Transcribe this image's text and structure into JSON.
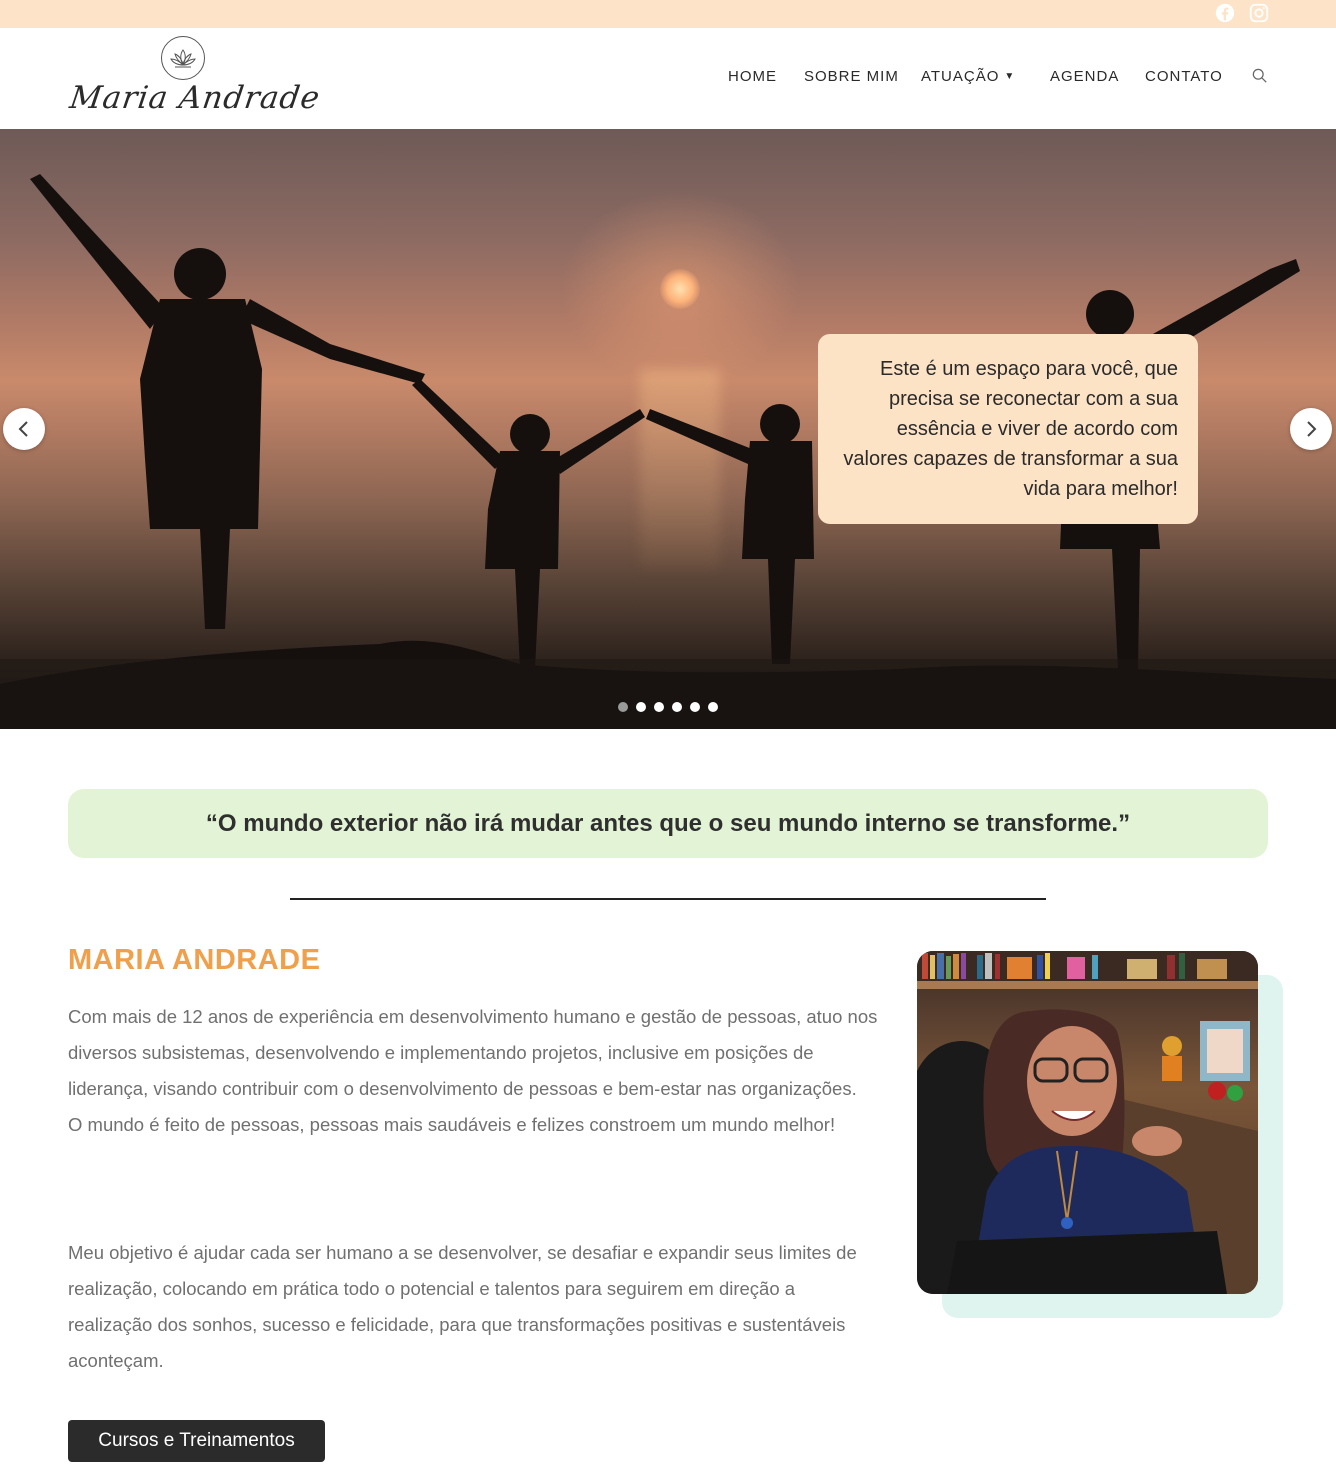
{
  "topbar": {
    "social": [
      "facebook-icon",
      "instagram-icon"
    ]
  },
  "header": {
    "logo_text": "Maria Andrade",
    "nav": [
      {
        "label": "HOME"
      },
      {
        "label": "SOBRE MIM"
      },
      {
        "label": "ATUAÇÃO"
      },
      {
        "label": "AGENDA"
      },
      {
        "label": "CONTATO"
      }
    ]
  },
  "hero": {
    "caption": "Este é um espaço para você, que precisa se reconectar com a sua essência e viver de acordo com valores capazes de transformar a sua vida para melhor!",
    "slide_count": 6,
    "active_slide": 1
  },
  "quote": "“O mundo exterior não irá mudar antes que o seu mundo interno se transforme.”",
  "about": {
    "title": "MARIA ANDRADE",
    "paragraph1_a": "Com mais de 12 anos de experiência em desenvolvimento humano e gestão de pessoas, atuo nos diversos subsistemas, desenvolvendo e implementando projetos, inclusive em posições de liderança, visando contribuir com o desenvolvimento de pessoas e bem-estar nas organizações.",
    "paragraph1_b": "O mundo é feito de pessoas, pessoas mais saudáveis e felizes constroem um mundo melhor!",
    "paragraph2": "Meu objetivo é ajudar cada ser humano a se desenvolver, se desafiar e expandir seus limites de realização, colocando em prática todo o potencial e talentos para seguirem em direção a realização dos sonhos, sucesso e felicidade, para que transformações positivas e sustentáveis aconteçam.",
    "cta_label": "Cursos e Treinamentos"
  },
  "colors": {
    "topbar": "#fde4c8",
    "caption_bg": "#fde3c6",
    "quote_bg": "#e3f3d6",
    "title_accent": "#f0a04b",
    "photo_accent_bg": "#dff4ef",
    "cta_bg": "#2b2b2b"
  }
}
